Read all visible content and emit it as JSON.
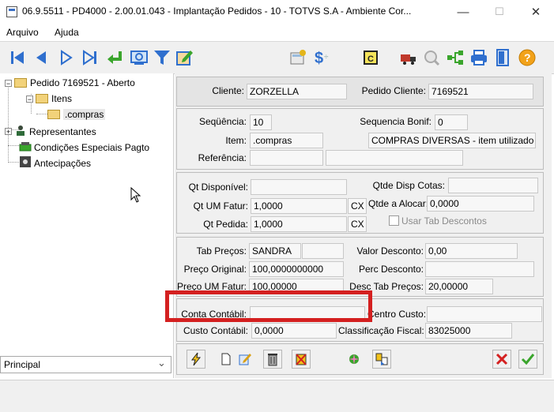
{
  "window": {
    "title": "06.9.5511 - PD4000 - 2.00.01.043 - Implantação Pedidos - 10 - TOTVS S.A - Ambiente Cor...",
    "min_glyph": "—",
    "max_glyph": "☐",
    "close_glyph": "✕"
  },
  "menu": {
    "items": [
      "Arquivo",
      "Ajuda"
    ]
  },
  "tree": {
    "root": "Pedido 7169521 - Aberto",
    "itens": "Itens",
    "compras": ".compras",
    "representantes": "Representantes",
    "condicoes": "Condições Especiais Pagto",
    "antecipacoes": "Antecipações"
  },
  "combo": {
    "value": "Principal",
    "arrow": "⌄"
  },
  "header_panel": {
    "cliente_label": "Cliente:",
    "cliente_value": "ZORZELLA",
    "pedido_label": "Pedido Cliente:",
    "pedido_value": "7169521"
  },
  "item_panel": {
    "sequencia_label": "Seqüência:",
    "sequencia_value": "10",
    "seq_bonif_label": "Sequencia Bonif:",
    "seq_bonif_value": "0",
    "item_label": "Item:",
    "item_value": ".compras",
    "item_desc": "COMPRAS DIVERSAS - item utilizado",
    "referencia_label": "Referência:",
    "referencia_value": ""
  },
  "qty_panel": {
    "qt_disp_label": "Qt Disponível:",
    "qt_disp_value": "",
    "qtde_cotas_label": "Qtde Disp Cotas:",
    "qtde_cotas_value": "",
    "qt_um_label": "Qt UM Fatur:",
    "qt_um_value": "1,0000",
    "qt_um_unit": "CX",
    "qtde_alocar_label": "Qtde a Alocar:",
    "qtde_alocar_value": "0,0000",
    "qt_pedida_label": "Qt Pedida:",
    "qt_pedida_value": "1,0000",
    "qt_pedida_unit": "CX",
    "usar_tab_label": "Usar Tab Descontos"
  },
  "price_panel": {
    "tab_precos_label": "Tab Preços:",
    "tab_precos_value": "SANDRA",
    "valor_desc_label": "Valor Desconto:",
    "valor_desc_value": "0,00",
    "preco_orig_label": "Preço Original:",
    "preco_orig_value": "100,0000000000",
    "perc_desc_label": "Perc Desconto:",
    "perc_desc_value": "",
    "preco_um_label": "Preço UM Fatur:",
    "preco_um_value": "100,00000",
    "desc_tab_label": "Desc Tab Preços:",
    "desc_tab_value": "20,00000"
  },
  "account_panel": {
    "conta_label": "Conta Contábil:",
    "conta_value": "",
    "centro_label": "Centro Custo:",
    "centro_value": "",
    "custo_label": "Custo Contábil:",
    "custo_value": "0,0000",
    "class_label": "Classificação Fiscal:",
    "class_value": "83025000"
  },
  "colors": {
    "highlight_box": "#d42020",
    "accent_blue": "#2f6fce",
    "panel_bg": "#f0f0f0"
  }
}
